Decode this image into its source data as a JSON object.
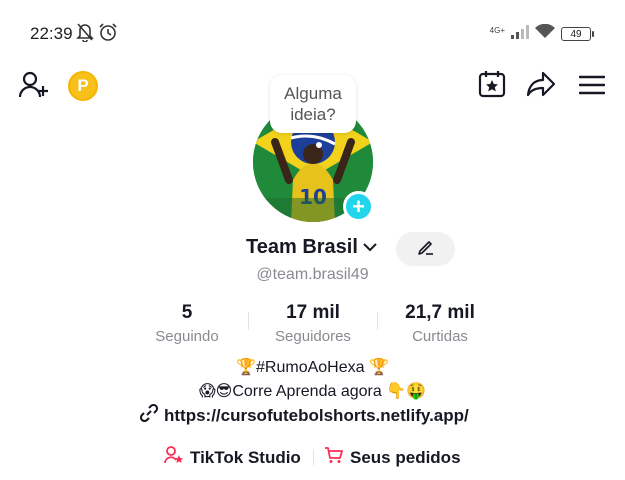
{
  "status_bar": {
    "time": "22:39",
    "network_label": "4G+",
    "battery_level": "49"
  },
  "header": {
    "note_text": "Alguma ideia?"
  },
  "profile": {
    "display_name": "Team Brasil",
    "username": "@team.brasil49"
  },
  "stats": [
    {
      "value": "5",
      "label": "Seguindo"
    },
    {
      "value": "17 mil",
      "label": "Seguidores"
    },
    {
      "value": "21,7 mil",
      "label": "Curtidas"
    }
  ],
  "bio": {
    "line1": "🏆#RumoAoHexa 🏆",
    "line2": "😱😎Corre Aprenda agora 👇🤑",
    "link": "https://cursofutebolshorts.netlify.app/"
  },
  "actions": {
    "studio_label": "TikTok Studio",
    "orders_label": "Seus pedidos"
  },
  "colors": {
    "accent_cyan": "#20d5ec",
    "accent_red": "#fe2c55",
    "coin_yellow": "#f7c01b",
    "muted_text": "#8a8b91"
  },
  "icons": [
    "mute-bell-icon",
    "alarm-icon",
    "signal-icon",
    "wifi-icon",
    "battery-icon",
    "add-friend-icon",
    "coin-icon",
    "calendar-star-icon",
    "share-icon",
    "menu-icon",
    "chevron-down-icon",
    "pencil-icon",
    "link-icon",
    "studio-icon",
    "cart-icon"
  ]
}
